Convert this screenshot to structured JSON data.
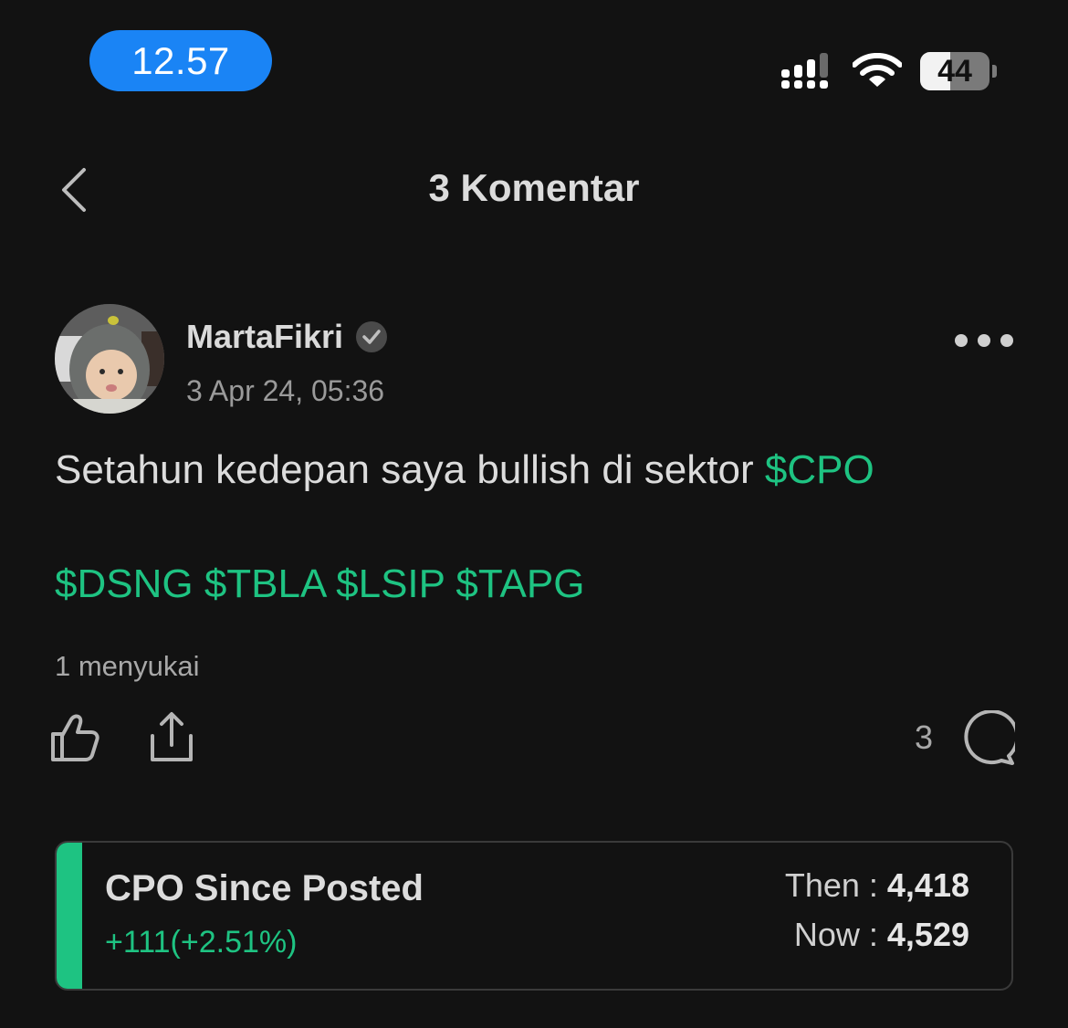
{
  "status_bar": {
    "time": "12.57",
    "battery": "44",
    "battery_level": 0.44,
    "signal_icon": "cellular-signal-icon",
    "wifi_icon": "wifi-icon"
  },
  "nav": {
    "title": "3 Komentar",
    "back_icon": "chevron-left-icon"
  },
  "post": {
    "username": "MartaFikri",
    "timestamp": "3 Apr 24, 05:36",
    "text": "Setahun kedepan saya bullish di sektor ",
    "inline_tag": "$CPO",
    "tags_line": "$DSNG $TBLA $LSIP $TAPG",
    "likes": "1 menyukai",
    "comment_count": "3"
  },
  "performance_card": {
    "title": "CPO Since Posted",
    "change": "+111(+2.51%)",
    "then_label": "Then : ",
    "then_value": "4,418",
    "now_label": "Now : ",
    "now_value": "4,529"
  },
  "colors": {
    "background": "#121212",
    "accent_green": "#1ec382",
    "time_pill": "#1a84f5"
  }
}
